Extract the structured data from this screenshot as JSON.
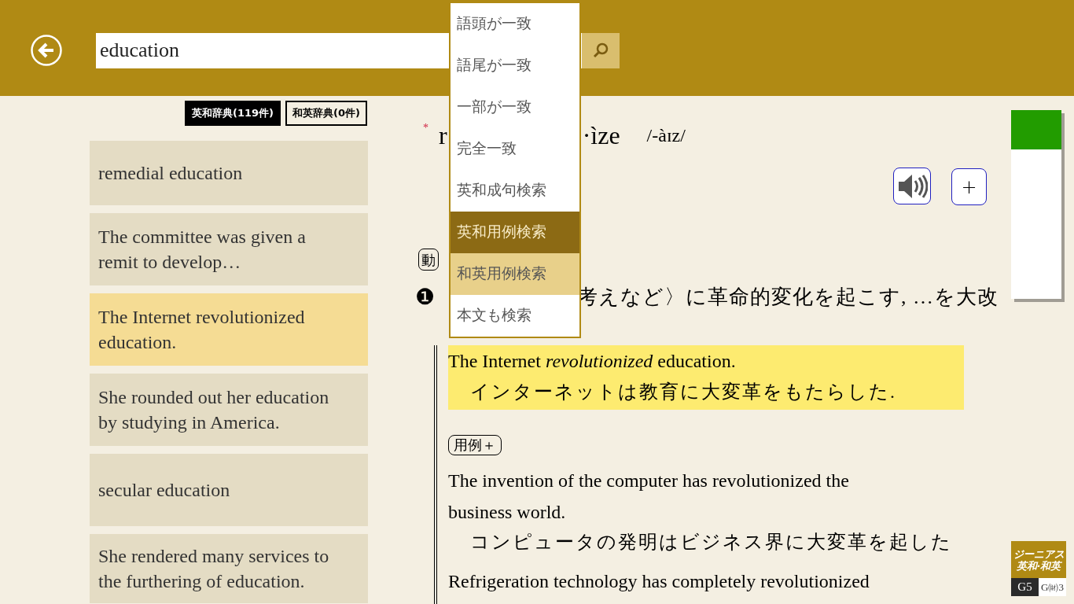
{
  "search": {
    "value": "education"
  },
  "dropdown": [
    {
      "label": "語頭が一致",
      "selected": false,
      "hovered": false
    },
    {
      "label": "語尾が一致",
      "selected": false,
      "hovered": false
    },
    {
      "label": "一部が一致",
      "selected": false,
      "hovered": false
    },
    {
      "label": "完全一致",
      "selected": false,
      "hovered": false
    },
    {
      "label": "英和成句検索",
      "selected": false,
      "hovered": false
    },
    {
      "label": "英和用例検索",
      "selected": true,
      "hovered": false
    },
    {
      "label": "和英用例検索",
      "selected": false,
      "hovered": true
    },
    {
      "label": "本文も検索",
      "selected": false,
      "hovered": false
    }
  ],
  "dict_tabs": [
    {
      "label": "英和辞典(119件)",
      "selected": true
    },
    {
      "label": "和英辞典(0件)",
      "selected": false
    }
  ],
  "results": [
    {
      "text": "remedial education",
      "selected": false
    },
    {
      "text": "The committee was given a remit to develop…",
      "selected": false
    },
    {
      "text": "The Internet revolutionized education.",
      "selected": true
    },
    {
      "text": "She rounded out her education by studying in America.",
      "selected": false
    },
    {
      "text": "secular education",
      "selected": false
    },
    {
      "text": "She rendered many services to the furthering of education.",
      "selected": false
    }
  ],
  "entry": {
    "mark": "*",
    "headword_start": "r",
    "headword_end": "·ìze",
    "pronunciation": "/-àɪz/",
    "pos": "動",
    "sense_number": "❶",
    "sense_text": "考えなど〉に革命的変化を起こす, …を大改",
    "highlighted_example": {
      "en": "The Internet *revolutionized* education.",
      "ja": "インターネットは教育に大変革をもたらした."
    },
    "more_examples_button": "用例＋",
    "examples": [
      {
        "en": "The invention of the computer has revolutionized the business world.",
        "ja": "コンピュータの発明はビジネス界に大変革を起した"
      },
      {
        "en": "Refrigeration technology has completely revolutionized"
      }
    ]
  },
  "plus_button": "+",
  "logo": {
    "title": "ジーニアス英和·和英",
    "left": "G5",
    "right": "G㈶3"
  }
}
